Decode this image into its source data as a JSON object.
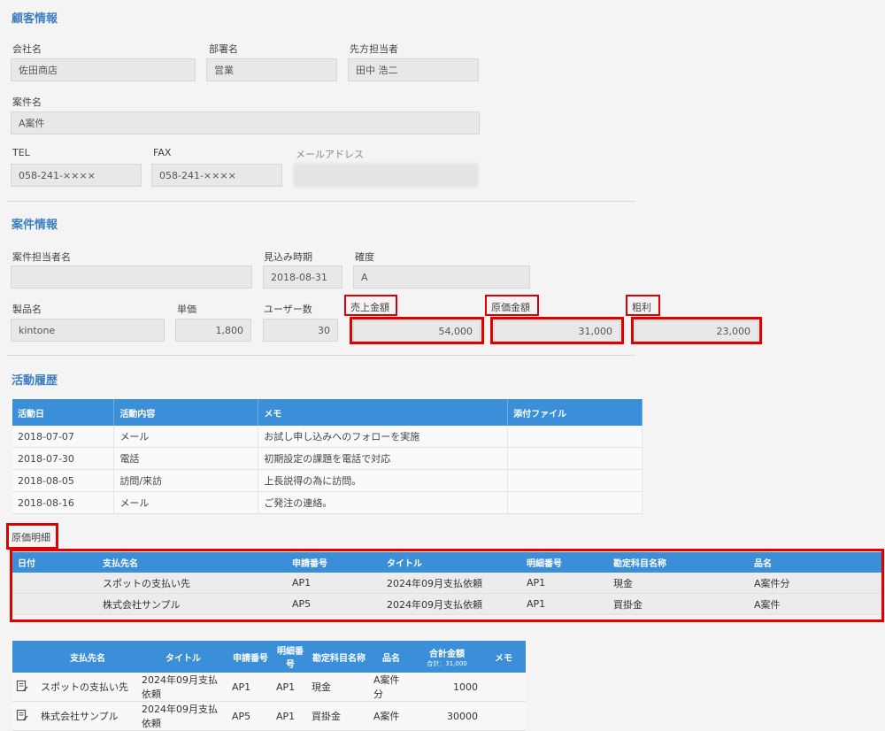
{
  "customer": {
    "title": "顧客情報",
    "company_label": "会社名",
    "company_value": "佐田商店",
    "dept_label": "部署名",
    "dept_value": "営業",
    "contact_label": "先方担当者",
    "contact_value": "田中 浩二",
    "case_label": "案件名",
    "case_value": "A案件",
    "tel_label": "TEL",
    "tel_value": "058-241-××××",
    "fax_label": "FAX",
    "fax_value": "058-241-××××",
    "email_label": "メールアドレス"
  },
  "case": {
    "title": "案件情報",
    "owner_label": "案件担当者名",
    "owner_value": "",
    "timing_label": "見込み時期",
    "timing_value": "2018-08-31",
    "certainty_label": "確度",
    "certainty_value": "A",
    "product_label": "製品名",
    "product_value": "kintone",
    "price_label": "単価",
    "price_value": "1,800",
    "users_label": "ユーザー数",
    "users_value": "30",
    "sales_label": "売上金額",
    "sales_value": "54,000",
    "cost_label": "原価金額",
    "cost_value": "31,000",
    "profit_label": "粗利",
    "profit_value": "23,000"
  },
  "activity": {
    "title": "活動履歴",
    "headers": [
      "活動日",
      "活動内容",
      "メモ",
      "添付ファイル"
    ],
    "rows": [
      [
        "2018-07-07",
        "メール",
        "お試し申し込みへのフォローを実施",
        ""
      ],
      [
        "2018-07-30",
        "電話",
        "初期設定の課題を電話で対応",
        ""
      ],
      [
        "2018-08-05",
        "訪問/来訪",
        "上長説得の為に訪問。",
        ""
      ],
      [
        "2018-08-16",
        "メール",
        "ご発注の連絡。",
        ""
      ]
    ]
  },
  "cost_detail": {
    "title": "原価明細",
    "headers": [
      "日付",
      "支払先名",
      "申請番号",
      "タイトル",
      "明細番号",
      "勘定科目名称",
      "品名"
    ],
    "rows": [
      [
        "",
        "スポットの支払い先",
        "AP1",
        "2024年09月支払依頼",
        "AP1",
        "現金",
        "A案件分"
      ],
      [
        "",
        "株式会社サンプル",
        "AP5",
        "2024年09月支払依頼",
        "AP1",
        "買掛金",
        "A案件"
      ]
    ]
  },
  "payment_list": {
    "headers": [
      "",
      "支払先名",
      "タイトル",
      "申請番号",
      "明細番号",
      "勘定科目名称",
      "品名",
      "合計金額",
      "メモ"
    ],
    "total_sub": "合計：31,000",
    "icon": "edit-document-icon",
    "rows": [
      [
        "スポットの支払い先",
        "2024年09月支払依頼",
        "AP1",
        "AP1",
        "現金",
        "A案件分",
        "1000",
        ""
      ],
      [
        "株式会社サンプル",
        "2024年09月支払依頼",
        "AP5",
        "AP1",
        "買掛金",
        "A案件",
        "30000",
        ""
      ]
    ]
  },
  "colors": {
    "header_blue": "#3a8fd8",
    "section_title": "#3d7fc1",
    "highlight_red": "#e00000"
  }
}
